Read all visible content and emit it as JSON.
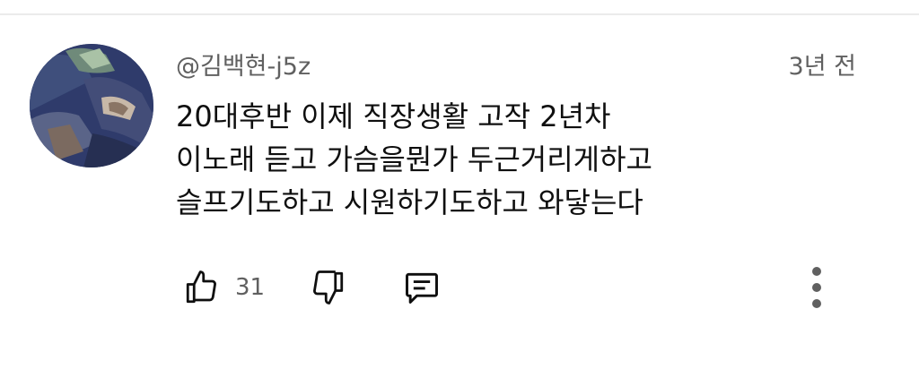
{
  "comment": {
    "author": "@김백현-j5z",
    "time": "3년 전",
    "lines": [
      "20대후반 이제 직장생활 고작 2년차",
      "이노래 듣고 가슴을뭔가 두근거리게하고",
      "슬프기도하고 시원하기도하고 와닿는다"
    ],
    "like_count": "31"
  },
  "icons": {
    "like": "thumbs-up-icon",
    "dislike": "thumbs-down-icon",
    "reply": "comment-icon",
    "more": "more-vertical-icon"
  },
  "colors": {
    "text_primary": "#0f0f0f",
    "text_secondary": "#606060",
    "divider": "#ebebeb"
  }
}
